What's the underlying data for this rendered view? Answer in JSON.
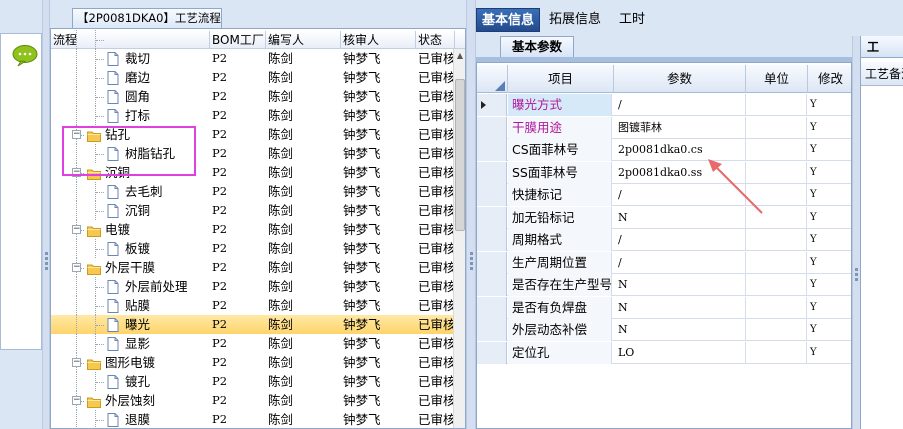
{
  "tree_panel": {
    "tab_title": "【2P0081DKA0】工艺流程",
    "columns": [
      "流程",
      "BOM工厂",
      "编写人",
      "核审人",
      "状态"
    ],
    "rows": [
      {
        "label": "",
        "level": 2,
        "type": "doc",
        "bom": "",
        "author": "",
        "reviewer": "",
        "status": ""
      },
      {
        "label": "裁切",
        "level": 2,
        "type": "doc",
        "bom": "P2",
        "author": "陈剑",
        "reviewer": "钟梦飞",
        "status": "已审核"
      },
      {
        "label": "磨边",
        "level": 2,
        "type": "doc",
        "bom": "P2",
        "author": "陈剑",
        "reviewer": "钟梦飞",
        "status": "已审核"
      },
      {
        "label": "圆角",
        "level": 2,
        "type": "doc",
        "bom": "P2",
        "author": "陈剑",
        "reviewer": "钟梦飞",
        "status": "已审核"
      },
      {
        "label": "打标",
        "level": 2,
        "type": "doc",
        "bom": "P2",
        "author": "陈剑",
        "reviewer": "钟梦飞",
        "status": "已审核"
      },
      {
        "label": "钻孔",
        "level": 1,
        "type": "folder",
        "bom": "P2",
        "author": "陈剑",
        "reviewer": "钟梦飞",
        "status": "已审核"
      },
      {
        "label": "树脂钻孔",
        "level": 2,
        "type": "doc",
        "bom": "P2",
        "author": "陈剑",
        "reviewer": "钟梦飞",
        "status": "已审核"
      },
      {
        "label": "沉铜",
        "level": 1,
        "type": "folder",
        "bom": "P2",
        "author": "陈剑",
        "reviewer": "钟梦飞",
        "status": "已审核"
      },
      {
        "label": "去毛刺",
        "level": 2,
        "type": "doc",
        "bom": "P2",
        "author": "陈剑",
        "reviewer": "钟梦飞",
        "status": "已审核"
      },
      {
        "label": "沉铜",
        "level": 2,
        "type": "doc",
        "bom": "P2",
        "author": "陈剑",
        "reviewer": "钟梦飞",
        "status": "已审核"
      },
      {
        "label": "电镀",
        "level": 1,
        "type": "folder",
        "bom": "P2",
        "author": "陈剑",
        "reviewer": "钟梦飞",
        "status": "已审核"
      },
      {
        "label": "板镀",
        "level": 2,
        "type": "doc",
        "bom": "P2",
        "author": "陈剑",
        "reviewer": "钟梦飞",
        "status": "已审核"
      },
      {
        "label": "外层干膜",
        "level": 1,
        "type": "folder",
        "bom": "P2",
        "author": "陈剑",
        "reviewer": "钟梦飞",
        "status": "已审核"
      },
      {
        "label": "外层前处理",
        "level": 2,
        "type": "doc",
        "bom": "P2",
        "author": "陈剑",
        "reviewer": "钟梦飞",
        "status": "已审核"
      },
      {
        "label": "贴膜",
        "level": 2,
        "type": "doc",
        "bom": "P2",
        "author": "陈剑",
        "reviewer": "钟梦飞",
        "status": "已审核"
      },
      {
        "label": "曝光",
        "level": 2,
        "type": "doc",
        "bom": "P2",
        "author": "陈剑",
        "reviewer": "钟梦飞",
        "status": "已审核",
        "selected": true
      },
      {
        "label": "显影",
        "level": 2,
        "type": "doc",
        "bom": "P2",
        "author": "陈剑",
        "reviewer": "钟梦飞",
        "status": "已审核"
      },
      {
        "label": "图形电镀",
        "level": 1,
        "type": "folder",
        "bom": "P2",
        "author": "陈剑",
        "reviewer": "钟梦飞",
        "status": "已审核"
      },
      {
        "label": "镀孔",
        "level": 2,
        "type": "doc",
        "bom": "P2",
        "author": "陈剑",
        "reviewer": "钟梦飞",
        "status": "已审核"
      },
      {
        "label": "外层蚀刻",
        "level": 1,
        "type": "folder",
        "bom": "P2",
        "author": "陈剑",
        "reviewer": "钟梦飞",
        "status": "已审核"
      },
      {
        "label": "退膜",
        "level": 2,
        "type": "doc",
        "bom": "P2",
        "author": "陈剑",
        "reviewer": "钟梦飞",
        "status": "已审核"
      }
    ]
  },
  "right_panel": {
    "top_tabs": [
      "基本信息",
      "拓展信息",
      "工时"
    ],
    "sub_tab": "基本参数",
    "grid_columns": [
      "项目",
      "参数",
      "单位",
      "修改"
    ],
    "rows": [
      {
        "item": "曝光方式",
        "param": "/",
        "unit": "",
        "edit": "Y",
        "item_color": "#b0189c",
        "current": true
      },
      {
        "item": "干膜用途",
        "param": "图镀菲林",
        "unit": "",
        "edit": "Y",
        "item_color": "#b0189c"
      },
      {
        "item": "CS面菲林号",
        "param": "2p0081dka0.cs",
        "unit": "",
        "edit": "Y",
        "item_color": "#000000"
      },
      {
        "item": "SS面菲林号",
        "param": "2p0081dka0.ss",
        "unit": "",
        "edit": "Y",
        "item_color": "#000000"
      },
      {
        "item": "快捷标记",
        "param": "/",
        "unit": "",
        "edit": "Y",
        "item_color": "#000000"
      },
      {
        "item": "加无铅标记",
        "param": "N",
        "unit": "",
        "edit": "Y",
        "item_color": "#000000"
      },
      {
        "item": "周期格式",
        "param": "/",
        "unit": "",
        "edit": "Y",
        "item_color": "#000000"
      },
      {
        "item": "生产周期位置",
        "param": "/",
        "unit": "",
        "edit": "Y",
        "item_color": "#000000"
      },
      {
        "item": "是否存在生产型号",
        "param": "N",
        "unit": "",
        "edit": "Y",
        "item_color": "#000000"
      },
      {
        "item": "是否有负焊盘",
        "param": "N",
        "unit": "",
        "edit": "Y",
        "item_color": "#000000"
      },
      {
        "item": "外层动态补偿",
        "param": "N",
        "unit": "",
        "edit": "Y",
        "item_color": "#000000"
      },
      {
        "item": "定位孔",
        "param": "LO",
        "unit": "",
        "edit": "Y",
        "item_color": "#000000"
      }
    ]
  },
  "far_right": {
    "tab_label": "工",
    "header_label": "工艺备注"
  },
  "colors": {
    "accent": "#224b8c",
    "highlight_box": "#e040e0",
    "annotation_arrow": "#e86a6a",
    "selected_row": "#ffd46a"
  }
}
